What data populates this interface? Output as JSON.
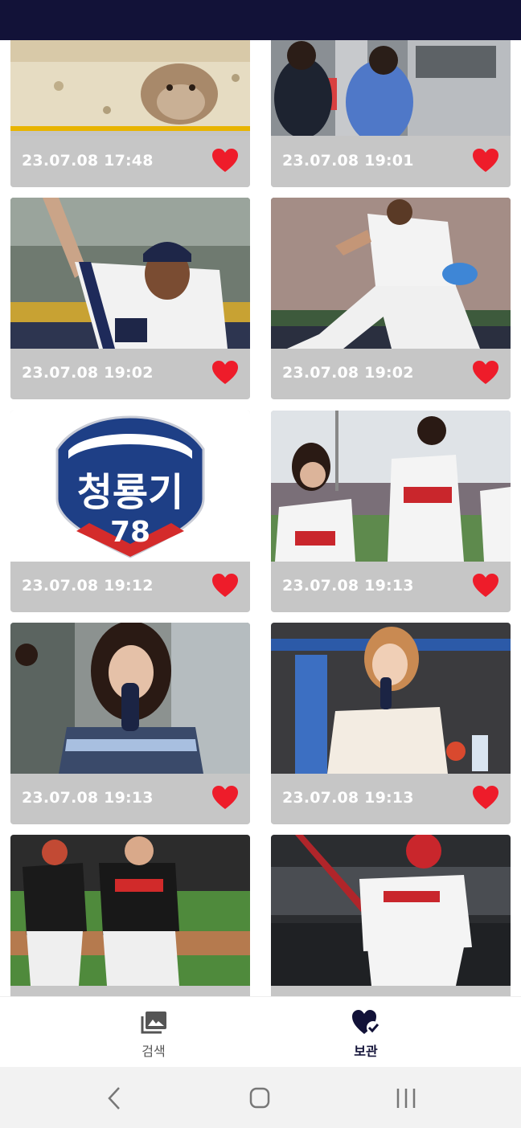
{
  "cards": [
    {
      "timestamp": "23.07.08 17:48",
      "favorite_icon": "heart-filled-icon",
      "photo": "hamster"
    },
    {
      "timestamp": "23.07.08 19:01",
      "favorite_icon": "heart-filled-icon",
      "photo": "two men at machine"
    },
    {
      "timestamp": "23.07.08 19:02",
      "favorite_icon": "heart-filled-icon",
      "photo": "pitcher close-up"
    },
    {
      "timestamp": "23.07.08 19:02",
      "favorite_icon": "heart-filled-icon",
      "photo": "pitcher throwing"
    },
    {
      "timestamp": "23.07.08 19:12",
      "favorite_icon": "heart-filled-icon",
      "photo": "tournament logo",
      "logo_text": "청룡기",
      "logo_number": "78"
    },
    {
      "timestamp": "23.07.08 19:13",
      "favorite_icon": "heart-filled-icon",
      "photo": "ceremonial first pitch"
    },
    {
      "timestamp": "23.07.08 19:13",
      "favorite_icon": "heart-filled-icon",
      "photo": "reporter with microphone"
    },
    {
      "timestamp": "23.07.08 19:13",
      "favorite_icon": "heart-filled-icon",
      "photo": "reporter in dugout"
    },
    {
      "timestamp": "",
      "favorite_icon": "heart-filled-icon",
      "photo": "tigers players"
    },
    {
      "timestamp": "",
      "favorite_icon": "heart-filled-icon",
      "photo": "tigers batter"
    }
  ],
  "bottom_nav": {
    "search": {
      "label": "검색",
      "icon": "photo-album-icon"
    },
    "saved": {
      "label": "보관",
      "icon": "heart-check-icon",
      "active": true
    }
  },
  "colors": {
    "status_bar": "#121238",
    "heart": "#ee1c2a",
    "caption_bg": "#c6c6c6",
    "active_nav": "#121238",
    "inactive_nav": "#555555"
  }
}
